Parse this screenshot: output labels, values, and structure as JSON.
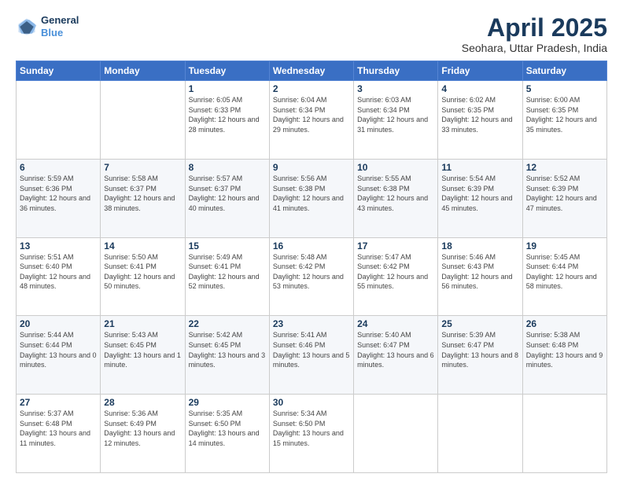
{
  "logo": {
    "line1": "General",
    "line2": "Blue"
  },
  "title": "April 2025",
  "subtitle": "Seohara, Uttar Pradesh, India",
  "days_of_week": [
    "Sunday",
    "Monday",
    "Tuesday",
    "Wednesday",
    "Thursday",
    "Friday",
    "Saturday"
  ],
  "weeks": [
    [
      {
        "day": "",
        "sunrise": "",
        "sunset": "",
        "daylight": ""
      },
      {
        "day": "",
        "sunrise": "",
        "sunset": "",
        "daylight": ""
      },
      {
        "day": "1",
        "sunrise": "Sunrise: 6:05 AM",
        "sunset": "Sunset: 6:33 PM",
        "daylight": "Daylight: 12 hours and 28 minutes."
      },
      {
        "day": "2",
        "sunrise": "Sunrise: 6:04 AM",
        "sunset": "Sunset: 6:34 PM",
        "daylight": "Daylight: 12 hours and 29 minutes."
      },
      {
        "day": "3",
        "sunrise": "Sunrise: 6:03 AM",
        "sunset": "Sunset: 6:34 PM",
        "daylight": "Daylight: 12 hours and 31 minutes."
      },
      {
        "day": "4",
        "sunrise": "Sunrise: 6:02 AM",
        "sunset": "Sunset: 6:35 PM",
        "daylight": "Daylight: 12 hours and 33 minutes."
      },
      {
        "day": "5",
        "sunrise": "Sunrise: 6:00 AM",
        "sunset": "Sunset: 6:35 PM",
        "daylight": "Daylight: 12 hours and 35 minutes."
      }
    ],
    [
      {
        "day": "6",
        "sunrise": "Sunrise: 5:59 AM",
        "sunset": "Sunset: 6:36 PM",
        "daylight": "Daylight: 12 hours and 36 minutes."
      },
      {
        "day": "7",
        "sunrise": "Sunrise: 5:58 AM",
        "sunset": "Sunset: 6:37 PM",
        "daylight": "Daylight: 12 hours and 38 minutes."
      },
      {
        "day": "8",
        "sunrise": "Sunrise: 5:57 AM",
        "sunset": "Sunset: 6:37 PM",
        "daylight": "Daylight: 12 hours and 40 minutes."
      },
      {
        "day": "9",
        "sunrise": "Sunrise: 5:56 AM",
        "sunset": "Sunset: 6:38 PM",
        "daylight": "Daylight: 12 hours and 41 minutes."
      },
      {
        "day": "10",
        "sunrise": "Sunrise: 5:55 AM",
        "sunset": "Sunset: 6:38 PM",
        "daylight": "Daylight: 12 hours and 43 minutes."
      },
      {
        "day": "11",
        "sunrise": "Sunrise: 5:54 AM",
        "sunset": "Sunset: 6:39 PM",
        "daylight": "Daylight: 12 hours and 45 minutes."
      },
      {
        "day": "12",
        "sunrise": "Sunrise: 5:52 AM",
        "sunset": "Sunset: 6:39 PM",
        "daylight": "Daylight: 12 hours and 47 minutes."
      }
    ],
    [
      {
        "day": "13",
        "sunrise": "Sunrise: 5:51 AM",
        "sunset": "Sunset: 6:40 PM",
        "daylight": "Daylight: 12 hours and 48 minutes."
      },
      {
        "day": "14",
        "sunrise": "Sunrise: 5:50 AM",
        "sunset": "Sunset: 6:41 PM",
        "daylight": "Daylight: 12 hours and 50 minutes."
      },
      {
        "day": "15",
        "sunrise": "Sunrise: 5:49 AM",
        "sunset": "Sunset: 6:41 PM",
        "daylight": "Daylight: 12 hours and 52 minutes."
      },
      {
        "day": "16",
        "sunrise": "Sunrise: 5:48 AM",
        "sunset": "Sunset: 6:42 PM",
        "daylight": "Daylight: 12 hours and 53 minutes."
      },
      {
        "day": "17",
        "sunrise": "Sunrise: 5:47 AM",
        "sunset": "Sunset: 6:42 PM",
        "daylight": "Daylight: 12 hours and 55 minutes."
      },
      {
        "day": "18",
        "sunrise": "Sunrise: 5:46 AM",
        "sunset": "Sunset: 6:43 PM",
        "daylight": "Daylight: 12 hours and 56 minutes."
      },
      {
        "day": "19",
        "sunrise": "Sunrise: 5:45 AM",
        "sunset": "Sunset: 6:44 PM",
        "daylight": "Daylight: 12 hours and 58 minutes."
      }
    ],
    [
      {
        "day": "20",
        "sunrise": "Sunrise: 5:44 AM",
        "sunset": "Sunset: 6:44 PM",
        "daylight": "Daylight: 13 hours and 0 minutes."
      },
      {
        "day": "21",
        "sunrise": "Sunrise: 5:43 AM",
        "sunset": "Sunset: 6:45 PM",
        "daylight": "Daylight: 13 hours and 1 minute."
      },
      {
        "day": "22",
        "sunrise": "Sunrise: 5:42 AM",
        "sunset": "Sunset: 6:45 PM",
        "daylight": "Daylight: 13 hours and 3 minutes."
      },
      {
        "day": "23",
        "sunrise": "Sunrise: 5:41 AM",
        "sunset": "Sunset: 6:46 PM",
        "daylight": "Daylight: 13 hours and 5 minutes."
      },
      {
        "day": "24",
        "sunrise": "Sunrise: 5:40 AM",
        "sunset": "Sunset: 6:47 PM",
        "daylight": "Daylight: 13 hours and 6 minutes."
      },
      {
        "day": "25",
        "sunrise": "Sunrise: 5:39 AM",
        "sunset": "Sunset: 6:47 PM",
        "daylight": "Daylight: 13 hours and 8 minutes."
      },
      {
        "day": "26",
        "sunrise": "Sunrise: 5:38 AM",
        "sunset": "Sunset: 6:48 PM",
        "daylight": "Daylight: 13 hours and 9 minutes."
      }
    ],
    [
      {
        "day": "27",
        "sunrise": "Sunrise: 5:37 AM",
        "sunset": "Sunset: 6:48 PM",
        "daylight": "Daylight: 13 hours and 11 minutes."
      },
      {
        "day": "28",
        "sunrise": "Sunrise: 5:36 AM",
        "sunset": "Sunset: 6:49 PM",
        "daylight": "Daylight: 13 hours and 12 minutes."
      },
      {
        "day": "29",
        "sunrise": "Sunrise: 5:35 AM",
        "sunset": "Sunset: 6:50 PM",
        "daylight": "Daylight: 13 hours and 14 minutes."
      },
      {
        "day": "30",
        "sunrise": "Sunrise: 5:34 AM",
        "sunset": "Sunset: 6:50 PM",
        "daylight": "Daylight: 13 hours and 15 minutes."
      },
      {
        "day": "",
        "sunrise": "",
        "sunset": "",
        "daylight": ""
      },
      {
        "day": "",
        "sunrise": "",
        "sunset": "",
        "daylight": ""
      },
      {
        "day": "",
        "sunrise": "",
        "sunset": "",
        "daylight": ""
      }
    ]
  ]
}
